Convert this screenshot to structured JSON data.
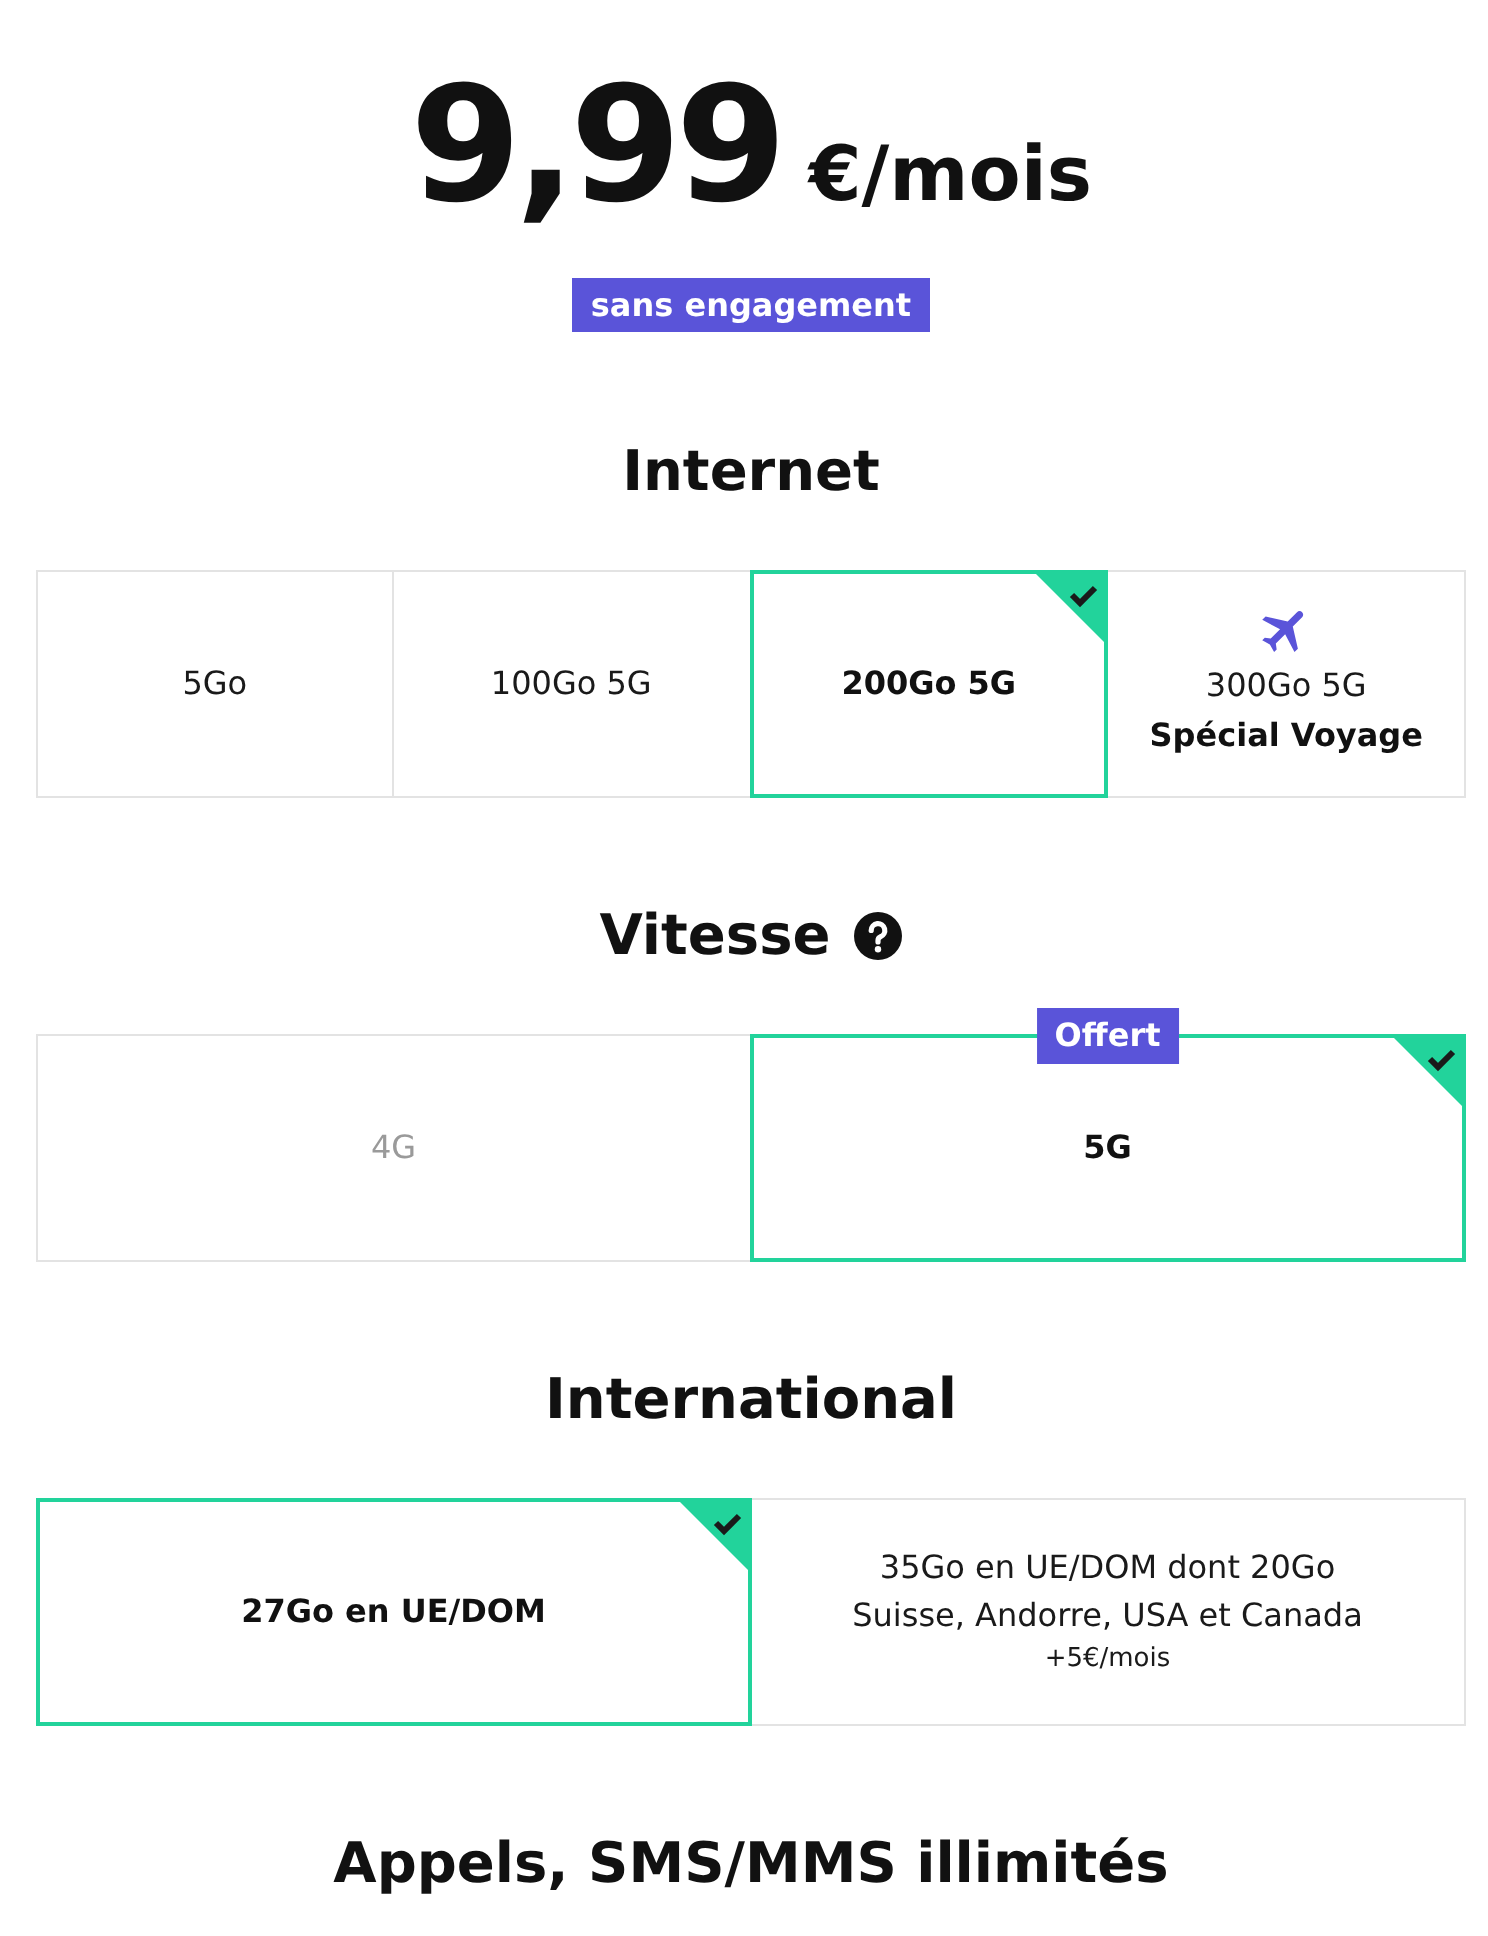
{
  "price": {
    "amount": "9,99",
    "unit": "€/mois"
  },
  "commitment_badge": "sans engagement",
  "sections": [
    {
      "title": "Internet",
      "help": false,
      "options": [
        {
          "kind": "plain",
          "label": "5Go",
          "selected": false
        },
        {
          "kind": "plain",
          "label": "100Go 5G",
          "selected": false
        },
        {
          "kind": "plain",
          "label": "200Go 5G",
          "selected": true
        },
        {
          "kind": "travel",
          "label": "300Go 5G",
          "sublabel": "Spécial Voyage",
          "selected": false
        }
      ]
    },
    {
      "title": "Vitesse",
      "help": true,
      "options": [
        {
          "kind": "plain",
          "label": "4G",
          "selected": false,
          "disabled": true
        },
        {
          "kind": "plain",
          "label": "5G",
          "selected": true,
          "disabled": false,
          "badge": "Offert"
        }
      ]
    },
    {
      "title": "International",
      "help": false,
      "options": [
        {
          "kind": "plain",
          "label": "27Go en UE/DOM",
          "selected": true
        },
        {
          "kind": "plain",
          "label": "35Go en UE/DOM dont 20Go Suisse, Andorre, USA et Canada",
          "price_note": "+5€/mois",
          "selected": false
        }
      ]
    },
    {
      "title": "Appels, SMS/MMS illimités",
      "help": false
    }
  ]
}
